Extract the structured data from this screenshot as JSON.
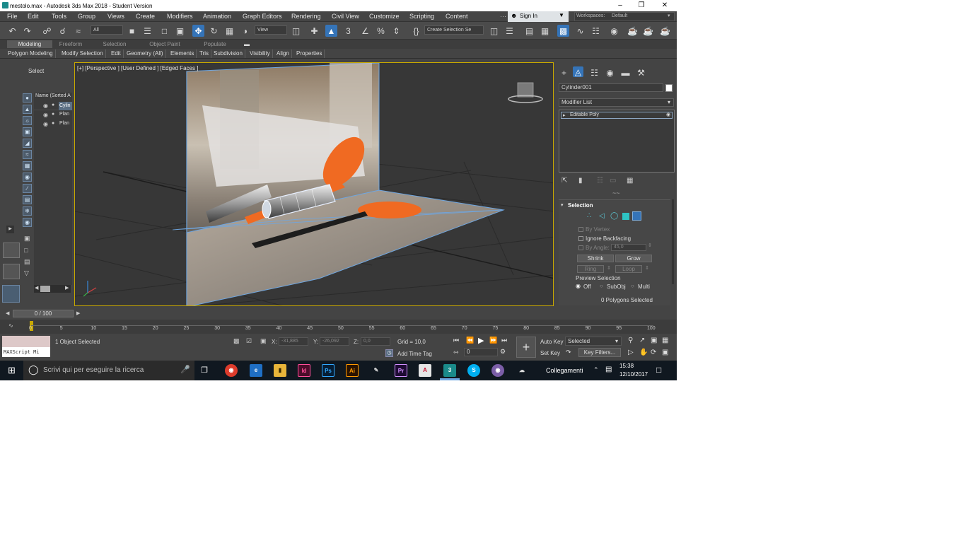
{
  "title": "mestolo.max - Autodesk 3ds Max 2018 - Student Version",
  "menu": [
    "File",
    "Edit",
    "Tools",
    "Group",
    "Views",
    "Create",
    "Modifiers",
    "Animation",
    "Graph Editors",
    "Rendering",
    "Civil View",
    "Customize",
    "Scripting",
    "Content"
  ],
  "signin": "Sign In",
  "workspaces_label": "Workspaces:",
  "workspaces_value": "Default",
  "toolbar": {
    "filter": "All",
    "ref_coord": "View",
    "selection_set": "Create Selection Se"
  },
  "ribbon_tabs": [
    "Modeling",
    "Freeform",
    "Selection",
    "Object Paint",
    "Populate"
  ],
  "ribbon_tools": [
    "Polygon Modeling",
    "Modify Selection",
    "Edit",
    "Geometry (All)",
    "Elements",
    "Tris",
    "Subdivision",
    "Visibility",
    "Align",
    "Properties"
  ],
  "explorer": {
    "select_label": "Select",
    "header": "Name (Sorted A",
    "items": [
      "Cylin",
      "Plan",
      "Plan"
    ]
  },
  "viewport": {
    "label": "[+] [Perspective ] [User Defined ] [Edged Faces ]"
  },
  "command_panel": {
    "object_name": "Cylinder001",
    "modifier_list": "Modifier List",
    "stack_item": "Editable Poly",
    "rollout_title": "Selection",
    "by_vertex": "By Vertex",
    "ignore_backfacing": "Ignore Backfacing",
    "by_angle": "By Angle:",
    "by_angle_value": "45,0",
    "shrink": "Shrink",
    "grow": "Grow",
    "ring": "Ring",
    "loop": "Loop",
    "preview_selection": "Preview Selection",
    "off": "Off",
    "subobj": "SubObj",
    "multi": "Multi",
    "selected_count": "0 Polygons Selected"
  },
  "timeline": {
    "frame": "0 / 100",
    "ticks": [
      "0",
      "5",
      "10",
      "15",
      "20",
      "25",
      "30",
      "35",
      "40",
      "45",
      "50",
      "55",
      "60",
      "65",
      "70",
      "75",
      "80",
      "85",
      "90",
      "95",
      "100"
    ]
  },
  "status": {
    "maxscript": "MAXScript Mi",
    "selected": "1 Object Selected",
    "x_label": "X:",
    "x_value": "-31,885",
    "y_label": "Y:",
    "y_value": "-26,092",
    "z_label": "Z:",
    "z_value": "0,0",
    "grid": "Grid = 10,0",
    "add_time_tag": "Add Time Tag",
    "auto_key": "Auto Key",
    "selected_dd": "Selected",
    "set_key": "Set Key",
    "key_filters": "Key Filters...",
    "frame_field": "0"
  },
  "taskbar": {
    "search": "Scrivi qui per eseguire la ricerca",
    "connections": "Collegamenti",
    "time": "15:38",
    "date": "12/10/2017"
  },
  "colors": {
    "accent": "#3574b8",
    "viewport_border": "#c8a800",
    "spoon": "#f06a22"
  }
}
